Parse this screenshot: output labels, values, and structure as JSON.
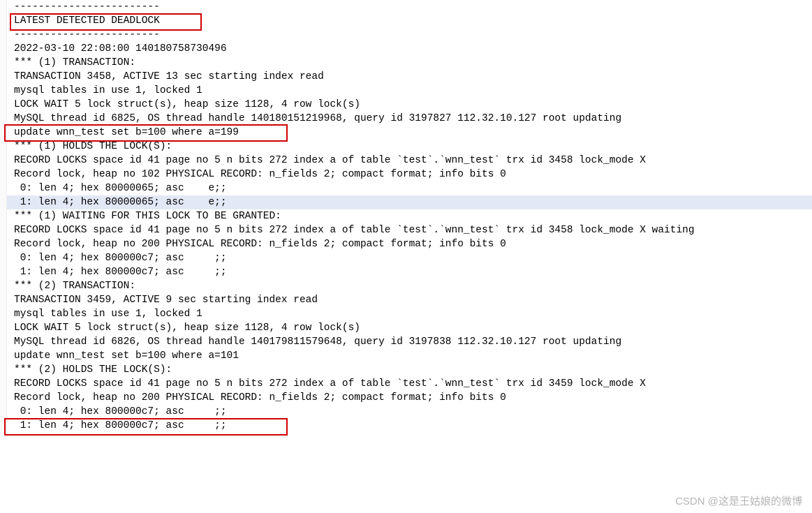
{
  "watermark": "CSDN @这是王姑娘的微博",
  "lines": [
    {
      "hl": false,
      "text": "------------------------"
    },
    {
      "hl": false,
      "text": "LATEST DETECTED DEADLOCK"
    },
    {
      "hl": false,
      "text": "------------------------"
    },
    {
      "hl": false,
      "text": "2022-03-10 22:08:00 140180758730496"
    },
    {
      "hl": false,
      "text": "*** (1) TRANSACTION:"
    },
    {
      "hl": false,
      "text": "TRANSACTION 3458, ACTIVE 13 sec starting index read"
    },
    {
      "hl": false,
      "text": "mysql tables in use 1, locked 1"
    },
    {
      "hl": false,
      "text": "LOCK WAIT 5 lock struct(s), heap size 1128, 4 row lock(s)"
    },
    {
      "hl": false,
      "text": "MySQL thread id 6825, OS thread handle 140180151219968, query id 3197827 112.32.10.127 root updating"
    },
    {
      "hl": false,
      "text": "update wnn_test set b=100 where a=199"
    },
    {
      "hl": false,
      "text": ""
    },
    {
      "hl": false,
      "text": "*** (1) HOLDS THE LOCK(S):"
    },
    {
      "hl": false,
      "text": "RECORD LOCKS space id 41 page no 5 n bits 272 index a of table `test`.`wnn_test` trx id 3458 lock_mode X"
    },
    {
      "hl": false,
      "text": "Record lock, heap no 102 PHYSICAL RECORD: n_fields 2; compact format; info bits 0"
    },
    {
      "hl": false,
      "text": " 0: len 4; hex 80000065; asc    e;;"
    },
    {
      "hl": true,
      "text": " 1: len 4; hex 80000065; asc    e;;"
    },
    {
      "hl": false,
      "text": ""
    },
    {
      "hl": false,
      "text": ""
    },
    {
      "hl": false,
      "text": "*** (1) WAITING FOR THIS LOCK TO BE GRANTED:"
    },
    {
      "hl": false,
      "text": "RECORD LOCKS space id 41 page no 5 n bits 272 index a of table `test`.`wnn_test` trx id 3458 lock_mode X waiting"
    },
    {
      "hl": false,
      "text": "Record lock, heap no 200 PHYSICAL RECORD: n_fields 2; compact format; info bits 0"
    },
    {
      "hl": false,
      "text": " 0: len 4; hex 800000c7; asc     ;;"
    },
    {
      "hl": false,
      "text": " 1: len 4; hex 800000c7; asc     ;;"
    },
    {
      "hl": false,
      "text": ""
    },
    {
      "hl": false,
      "text": ""
    },
    {
      "hl": false,
      "text": "*** (2) TRANSACTION:"
    },
    {
      "hl": false,
      "text": "TRANSACTION 3459, ACTIVE 9 sec starting index read"
    },
    {
      "hl": false,
      "text": "mysql tables in use 1, locked 1"
    },
    {
      "hl": false,
      "text": "LOCK WAIT 5 lock struct(s), heap size 1128, 4 row lock(s)"
    },
    {
      "hl": false,
      "text": "MySQL thread id 6826, OS thread handle 140179811579648, query id 3197838 112.32.10.127 root updating"
    },
    {
      "hl": false,
      "text": "update wnn_test set b=100 where a=101"
    },
    {
      "hl": false,
      "text": ""
    },
    {
      "hl": false,
      "text": "*** (2) HOLDS THE LOCK(S):"
    },
    {
      "hl": false,
      "text": "RECORD LOCKS space id 41 page no 5 n bits 272 index a of table `test`.`wnn_test` trx id 3459 lock_mode X"
    },
    {
      "hl": false,
      "text": "Record lock, heap no 200 PHYSICAL RECORD: n_fields 2; compact format; info bits 0"
    },
    {
      "hl": false,
      "text": " 0: len 4; hex 800000c7; asc     ;;"
    },
    {
      "hl": false,
      "text": " 1: len 4; hex 800000c7; asc     ;;"
    }
  ]
}
